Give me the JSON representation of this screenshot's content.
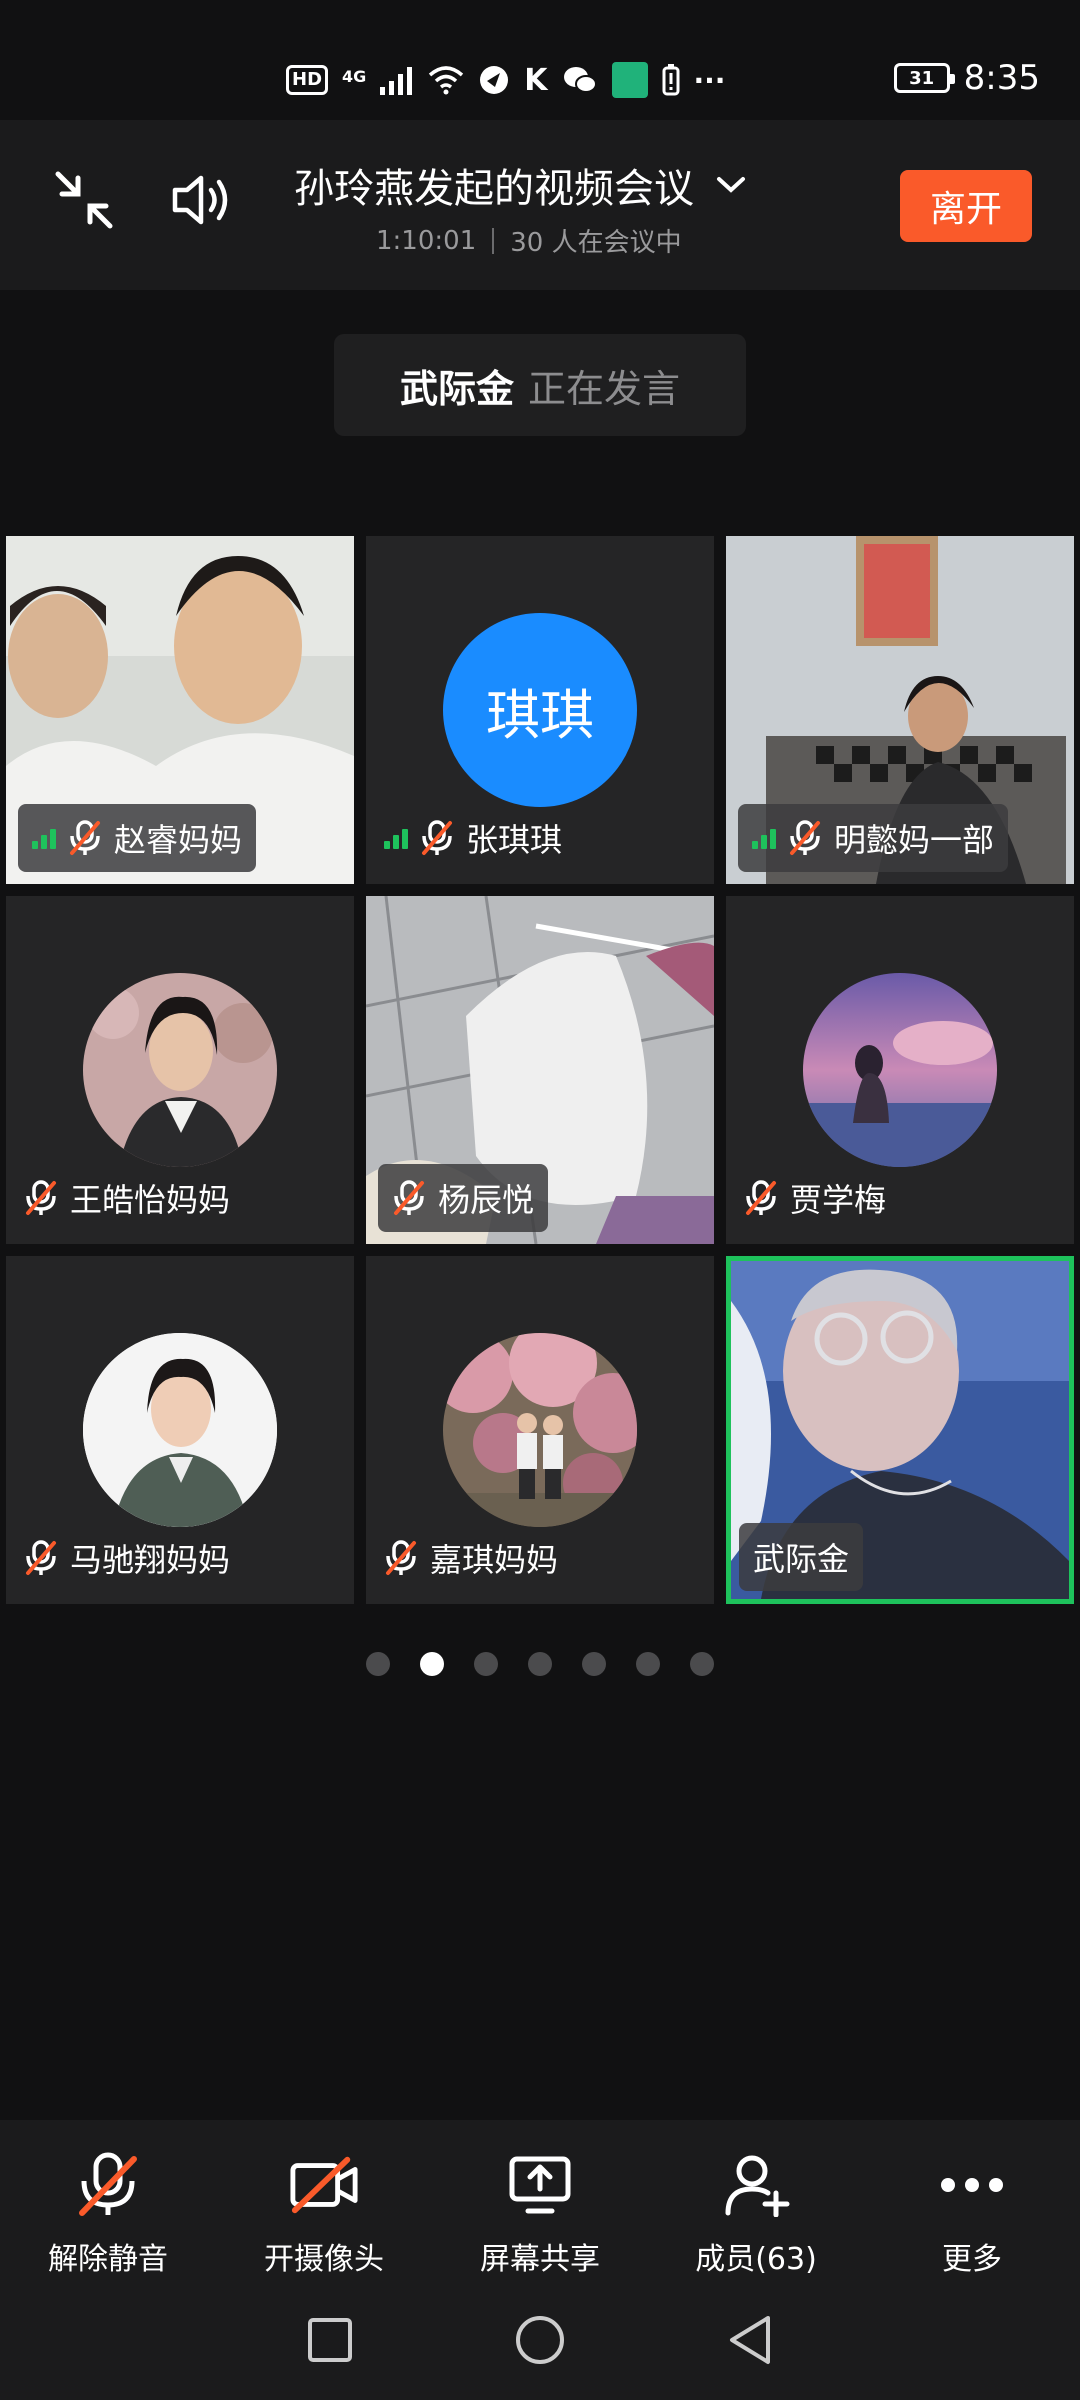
{
  "status_bar": {
    "hd": "HD",
    "net": "4G",
    "battery": "31",
    "time": "8:35"
  },
  "header": {
    "title": "孙玲燕发起的视频会议",
    "duration": "1:10:01",
    "participants": "30 人在会议中",
    "leave_label": "离开"
  },
  "speaking": {
    "name": "武际金",
    "status": "正在发言"
  },
  "tiles": [
    {
      "name": "赵睿妈妈"
    },
    {
      "name": "张琪琪",
      "avatar_text": "琪琪"
    },
    {
      "name": "明懿妈一部"
    },
    {
      "name": "王皓怡妈妈"
    },
    {
      "name": "杨辰悦"
    },
    {
      "name": "贾学梅"
    },
    {
      "name": "马驰翔妈妈"
    },
    {
      "name": "嘉琪妈妈"
    },
    {
      "name": "武际金"
    }
  ],
  "pagination": {
    "total": 7,
    "active_index": 1
  },
  "toolbar": {
    "unmute": "解除静音",
    "camera": "开摄像头",
    "share": "屏幕共享",
    "members": "成员(63)",
    "more": "更多"
  },
  "colors": {
    "accent_orange": "#fa5a2a",
    "speaker_green": "#1ec25c",
    "avatar_blue": "#1a8cff"
  }
}
